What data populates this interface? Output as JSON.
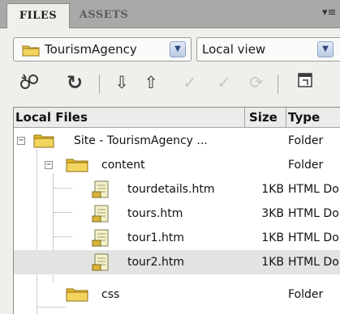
{
  "tabs": [
    {
      "label": "FILES",
      "active": true
    },
    {
      "label": "ASSETS",
      "active": false
    }
  ],
  "panel_options_icon": "options-menu-icon",
  "site_select": {
    "value": "TourismAgency",
    "icon": "folder-icon"
  },
  "view_select": {
    "value": "Local view"
  },
  "toolbar": [
    {
      "name": "connect-icon",
      "glyph": "⛓",
      "enabled": true
    },
    {
      "name": "refresh-icon",
      "glyph": "↻",
      "enabled": true
    },
    {
      "name": "get-files-icon",
      "glyph": "⇩",
      "enabled": true
    },
    {
      "name": "put-files-icon",
      "glyph": "⇧",
      "enabled": true
    },
    {
      "name": "check-out-icon",
      "glyph": "✓",
      "enabled": false
    },
    {
      "name": "check-in-icon",
      "glyph": "✓",
      "enabled": false
    },
    {
      "name": "synchronize-icon",
      "glyph": "⟳",
      "enabled": false
    },
    {
      "name": "expand-panel-icon",
      "glyph": "⤢",
      "enabled": true
    }
  ],
  "columns": {
    "local": "Local Files",
    "size": "Size",
    "type": "Type"
  },
  "files": [
    {
      "name": "Site - TourismAgency ...",
      "size": "",
      "type": "Folder",
      "kind": "site"
    },
    {
      "name": "content",
      "size": "",
      "type": "Folder",
      "kind": "folder"
    },
    {
      "name": "tourdetails.htm",
      "size": "1KB",
      "type": "HTML Do",
      "kind": "file"
    },
    {
      "name": "tours.htm",
      "size": "3KB",
      "type": "HTML Do",
      "kind": "file"
    },
    {
      "name": "tour1.htm",
      "size": "1KB",
      "type": "HTML Do",
      "kind": "file"
    },
    {
      "name": "tour2.htm",
      "size": "1KB",
      "type": "HTML Do",
      "kind": "file",
      "selected": true
    },
    {
      "name": "css",
      "size": "",
      "type": "Folder",
      "kind": "folder"
    }
  ],
  "colors": {
    "folder": "#e8c33a",
    "file_page": "#f4f1c8",
    "selection": "#e3e3e1"
  }
}
